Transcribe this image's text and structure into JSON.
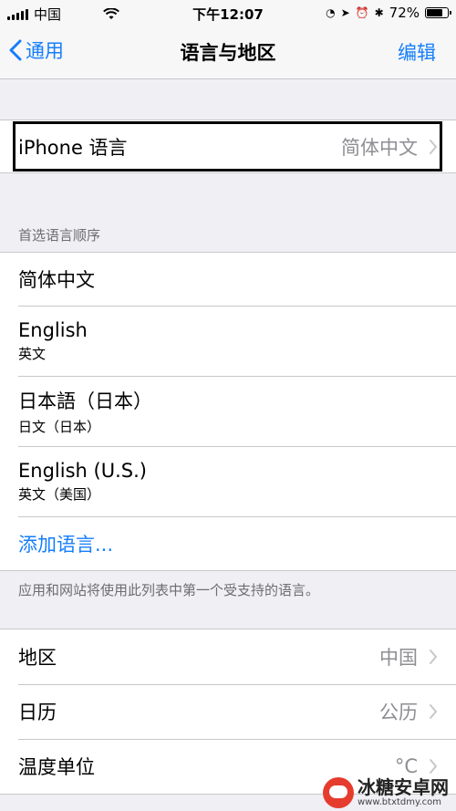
{
  "status_bar": {
    "carrier": "中国",
    "time": "下午12:07",
    "battery_text": "72%",
    "battery_level": 0.72,
    "icons": [
      "signal-icon",
      "wifi-icon",
      "lock-rotation-icon",
      "location-icon",
      "alarm-icon",
      "bluetooth-icon",
      "battery-icon"
    ]
  },
  "nav": {
    "back_label": "通用",
    "title": "语言与地区",
    "edit_label": "编辑"
  },
  "iphone_language": {
    "label": "iPhone 语言",
    "value": "简体中文"
  },
  "preferred_order": {
    "header": "首选语言顺序",
    "languages": [
      {
        "name": "简体中文",
        "sub": ""
      },
      {
        "name": "English",
        "sub": "英文"
      },
      {
        "name": "日本語（日本）",
        "sub": "日文（日本）"
      },
      {
        "name": "English (U.S.)",
        "sub": "英文（美国）"
      }
    ],
    "add_label": "添加语言...",
    "footer": "应用和网站将使用此列表中第一个受支持的语言。"
  },
  "region": {
    "rows": [
      {
        "label": "地区",
        "value": "中国"
      },
      {
        "label": "日历",
        "value": "公历"
      },
      {
        "label": "温度单位",
        "value": "°C"
      }
    ]
  },
  "watermark": {
    "title": "冰糖安卓网",
    "url": "www.btxtdmy.com"
  },
  "colors": {
    "accent": "#157efb",
    "background": "#efeff4",
    "secondary_text": "#8e8e93"
  }
}
